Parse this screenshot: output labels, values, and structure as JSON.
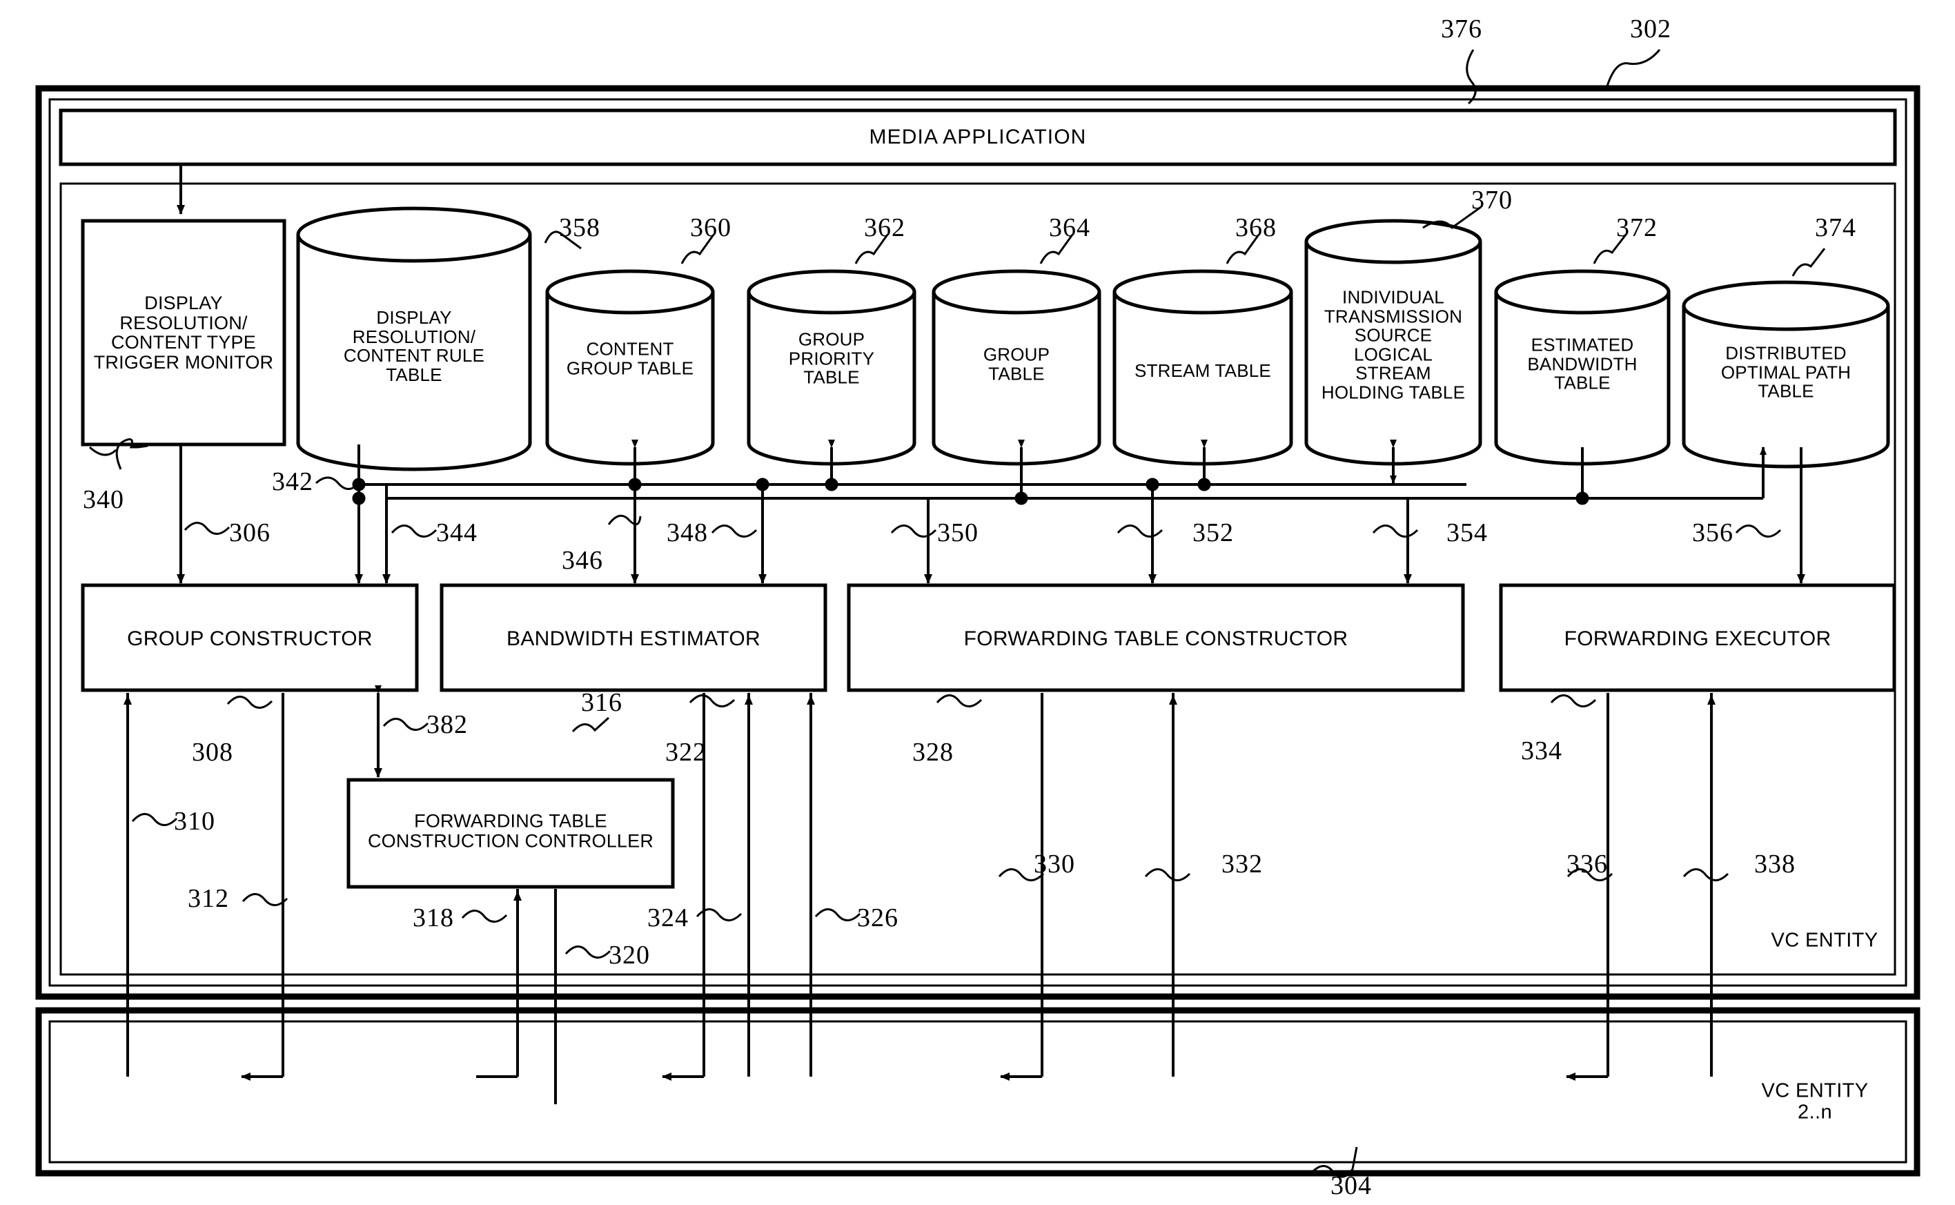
{
  "figure": {
    "type": "patent-block-diagram",
    "top_refs": [
      {
        "id": "ref-376",
        "text": "376"
      },
      {
        "id": "ref-302",
        "text": "302"
      }
    ],
    "media_application": {
      "label": "MEDIA APPLICATION"
    },
    "entity_labels": {
      "primary": "VC ENTITY",
      "secondary": "VC ENTITY 2..n",
      "secondary_ref": "304"
    }
  },
  "monitor_block": {
    "label": "DISPLAY\nRESOLUTION/\nCONTENT TYPE\nTRIGGER MONITOR",
    "ref": "340"
  },
  "tables": [
    {
      "label": "DISPLAY\nRESOLUTION/\nCONTENT RULE\nTABLE",
      "ref": "358"
    },
    {
      "label": "CONTENT\nGROUP TABLE",
      "ref": "360"
    },
    {
      "label": "GROUP\nPRIORITY\nTABLE",
      "ref": "362"
    },
    {
      "label": "GROUP\nTABLE",
      "ref": "364"
    },
    {
      "label": "STREAM TABLE",
      "ref": "368"
    },
    {
      "label": "INDIVIDUAL\nTRANSMISSION\nSOURCE\nLOGICAL\nSTREAM\nHOLDING TABLE",
      "ref": "370"
    },
    {
      "label": "ESTIMATED\nBANDWIDTH\nTABLE",
      "ref": "372"
    },
    {
      "label": "DISTRIBUTED\nOPTIMAL PATH\nTABLE",
      "ref": "374"
    }
  ],
  "processors": [
    {
      "label": "GROUP CONSTRUCTOR"
    },
    {
      "label": "BANDWIDTH ESTIMATOR"
    },
    {
      "label": "FORWARDING TABLE CONSTRUCTOR"
    },
    {
      "label": "FORWARDING EXECUTOR"
    }
  ],
  "controller": {
    "label": "FORWARDING TABLE\nCONSTRUCTION CONTROLLER",
    "ref": "316"
  },
  "signal_refs": [
    {
      "text": "306"
    },
    {
      "text": "342"
    },
    {
      "text": "344"
    },
    {
      "text": "346"
    },
    {
      "text": "348"
    },
    {
      "text": "350"
    },
    {
      "text": "352"
    },
    {
      "text": "354"
    },
    {
      "text": "356"
    },
    {
      "text": "308"
    },
    {
      "text": "310"
    },
    {
      "text": "312"
    },
    {
      "text": "382"
    },
    {
      "text": "322"
    },
    {
      "text": "318"
    },
    {
      "text": "320"
    },
    {
      "text": "324"
    },
    {
      "text": "326"
    },
    {
      "text": "328"
    },
    {
      "text": "330"
    },
    {
      "text": "332"
    },
    {
      "text": "334"
    },
    {
      "text": "336"
    },
    {
      "text": "338"
    }
  ],
  "colors": {
    "ink": "#000000",
    "paper": "#ffffff"
  }
}
